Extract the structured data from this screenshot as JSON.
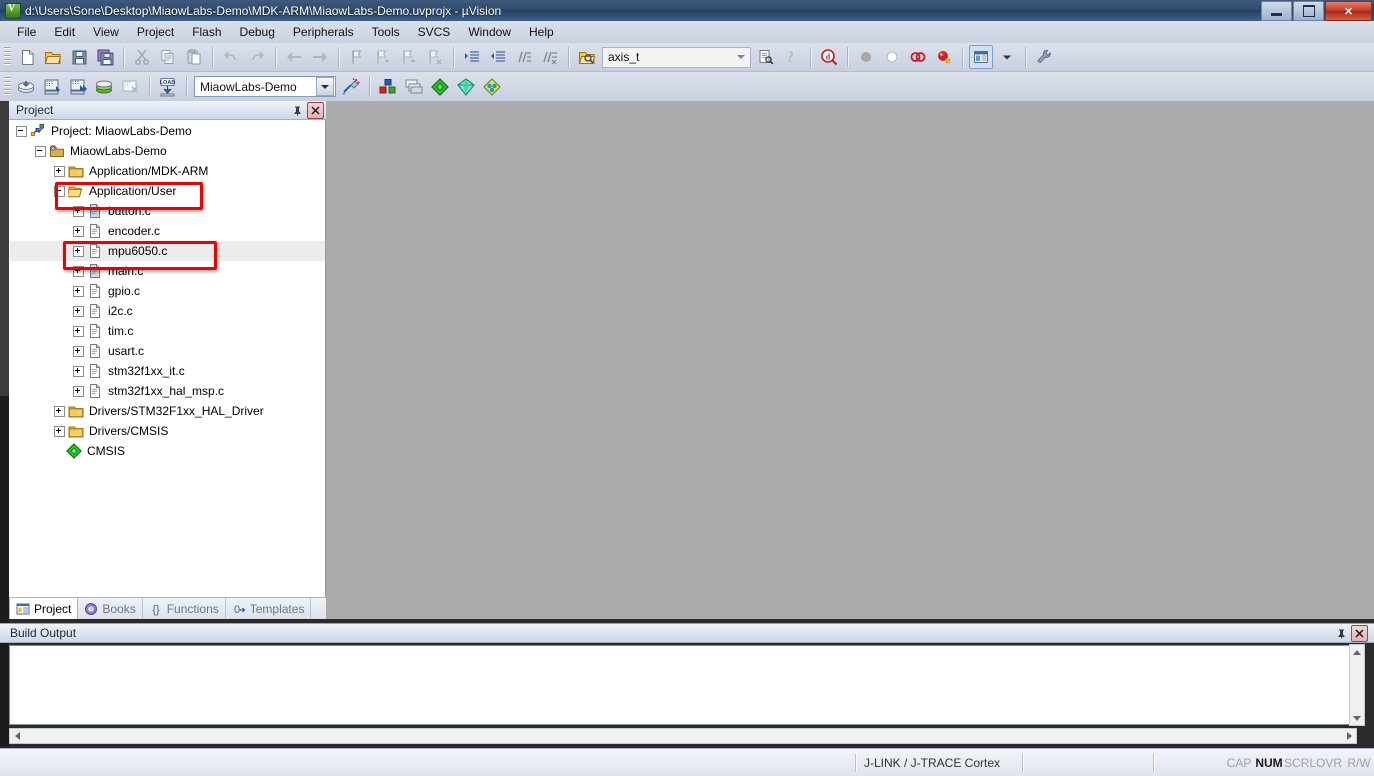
{
  "window": {
    "title": "d:\\Users\\Sone\\Desktop\\MiaowLabs-Demo\\MDK-ARM\\MiaowLabs-Demo.uvprojx - µVision",
    "minimize_label": "Minimize",
    "maximize_label": "Maximize",
    "close_label": "✕"
  },
  "menubar": {
    "items": [
      {
        "label": "File"
      },
      {
        "label": "Edit"
      },
      {
        "label": "View"
      },
      {
        "label": "Project"
      },
      {
        "label": "Flash"
      },
      {
        "label": "Debug"
      },
      {
        "label": "Peripherals"
      },
      {
        "label": "Tools"
      },
      {
        "label": "SVCS"
      },
      {
        "label": "Window"
      },
      {
        "label": "Help"
      }
    ]
  },
  "toolbar_main": {
    "buttons": [
      {
        "name": "new-file-icon",
        "tip": "New"
      },
      {
        "name": "open-file-icon",
        "tip": "Open"
      },
      {
        "name": "save-icon",
        "tip": "Save"
      },
      {
        "name": "save-all-icon",
        "tip": "Save All"
      },
      {
        "name": "cut-icon",
        "tip": "Cut"
      },
      {
        "name": "copy-icon",
        "tip": "Copy"
      },
      {
        "name": "paste-icon",
        "tip": "Paste"
      },
      {
        "name": "undo-icon",
        "tip": "Undo"
      },
      {
        "name": "redo-icon",
        "tip": "Redo"
      },
      {
        "name": "navigate-back-icon",
        "tip": "Back"
      },
      {
        "name": "navigate-forward-icon",
        "tip": "Forward"
      },
      {
        "name": "bookmark-toggle-icon",
        "tip": "Insert/Remove Bookmark"
      },
      {
        "name": "bookmark-prev-icon",
        "tip": "Previous Bookmark"
      },
      {
        "name": "bookmark-next-icon",
        "tip": "Next Bookmark"
      },
      {
        "name": "bookmark-clear-icon",
        "tip": "Clear All Bookmarks"
      },
      {
        "name": "indent-increase-icon",
        "tip": "Indent"
      },
      {
        "name": "indent-decrease-icon",
        "tip": "Outdent"
      },
      {
        "name": "comment-icon",
        "tip": "Comment"
      },
      {
        "name": "uncomment-icon",
        "tip": "Uncomment"
      }
    ],
    "find_box": {
      "value": "axis_t",
      "placeholder": ""
    },
    "find_buttons": [
      {
        "name": "find-in-files-icon",
        "tip": "Find in Files"
      },
      {
        "name": "incremental-find-icon",
        "tip": "Incremental Find"
      },
      {
        "name": "browse-symbol-icon",
        "tip": "Browse Symbol"
      }
    ],
    "debug_buttons": [
      {
        "name": "breakpoint-insert-icon",
        "tip": "Insert/Remove Breakpoint"
      },
      {
        "name": "breakpoint-enable-icon",
        "tip": "Enable/Disable Breakpoint"
      },
      {
        "name": "breakpoint-disable-all-icon",
        "tip": "Disable All Breakpoints"
      },
      {
        "name": "breakpoint-kill-all-icon",
        "tip": "Kill All Breakpoints"
      }
    ],
    "right_buttons": [
      {
        "name": "window-layout-icon",
        "tip": "Manage Window Layout"
      },
      {
        "name": "configure-icon",
        "tip": "Configuration Wizard"
      }
    ]
  },
  "toolbar_build": {
    "buttons": [
      {
        "name": "translate-icon",
        "tip": "Translate Current File"
      },
      {
        "name": "build-icon",
        "tip": "Build"
      },
      {
        "name": "rebuild-icon",
        "tip": "Rebuild"
      },
      {
        "name": "batch-build-icon",
        "tip": "Batch Build"
      },
      {
        "name": "stop-build-icon",
        "tip": "Stop Build"
      },
      {
        "name": "download-icon",
        "tip": "Download"
      }
    ],
    "target_select": {
      "value": "MiaowLabs-Demo"
    },
    "after_buttons": [
      {
        "name": "target-options-icon",
        "tip": "Options for Target"
      },
      {
        "name": "manage-project-items-icon",
        "tip": "Manage Project Items"
      },
      {
        "name": "multi-project-icon",
        "tip": "Manage Multi-Project"
      },
      {
        "name": "pack-installer-icon",
        "tip": "Pack Installer"
      },
      {
        "name": "manage-rte-icon",
        "tip": "Manage Run-Time Environment"
      },
      {
        "name": "select-software-packs-icon",
        "tip": "Select Software Packs"
      }
    ]
  },
  "project_panel": {
    "title": "Project",
    "pin_label": "Auto Hide",
    "close_label": "Close",
    "tree": [
      {
        "label": "Project: MiaowLabs-Demo",
        "depth": 0,
        "icon": "project-icon",
        "expander": "minus",
        "selected": false,
        "highlight": false
      },
      {
        "label": "MiaowLabs-Demo",
        "depth": 1,
        "icon": "target-icon",
        "expander": "minus",
        "selected": false,
        "highlight": false
      },
      {
        "label": "Application/MDK-ARM",
        "depth": 2,
        "icon": "folder-icon",
        "expander": "plus",
        "selected": false,
        "highlight": false
      },
      {
        "label": "Application/User",
        "depth": 2,
        "icon": "folder-open-icon",
        "expander": "minus",
        "selected": false,
        "highlight": true
      },
      {
        "label": "button.c",
        "depth": 3,
        "icon": "file-c-sel-icon",
        "expander": "plus",
        "selected": false,
        "highlight": false
      },
      {
        "label": "encoder.c",
        "depth": 3,
        "icon": "file-c-icon",
        "expander": "plus",
        "selected": false,
        "highlight": false
      },
      {
        "label": "mpu6050.c",
        "depth": 3,
        "icon": "file-c-icon",
        "expander": "plus",
        "selected": true,
        "highlight": true
      },
      {
        "label": "main.c",
        "depth": 3,
        "icon": "file-c-sel-icon",
        "expander": "plus",
        "selected": false,
        "highlight": false
      },
      {
        "label": "gpio.c",
        "depth": 3,
        "icon": "file-c-icon",
        "expander": "plus",
        "selected": false,
        "highlight": false
      },
      {
        "label": "i2c.c",
        "depth": 3,
        "icon": "file-c-icon",
        "expander": "plus",
        "selected": false,
        "highlight": false
      },
      {
        "label": "tim.c",
        "depth": 3,
        "icon": "file-c-icon",
        "expander": "plus",
        "selected": false,
        "highlight": false
      },
      {
        "label": "usart.c",
        "depth": 3,
        "icon": "file-c-icon",
        "expander": "plus",
        "selected": false,
        "highlight": false
      },
      {
        "label": "stm32f1xx_it.c",
        "depth": 3,
        "icon": "file-c-icon",
        "expander": "plus",
        "selected": false,
        "highlight": false
      },
      {
        "label": "stm32f1xx_hal_msp.c",
        "depth": 3,
        "icon": "file-c-icon",
        "expander": "plus",
        "selected": false,
        "highlight": false
      },
      {
        "label": "Drivers/STM32F1xx_HAL_Driver",
        "depth": 2,
        "icon": "folder-icon",
        "expander": "plus",
        "selected": false,
        "highlight": false
      },
      {
        "label": "Drivers/CMSIS",
        "depth": 2,
        "icon": "folder-icon",
        "expander": "plus",
        "selected": false,
        "highlight": false
      },
      {
        "label": "CMSIS",
        "depth": 2,
        "icon": "cmsis-icon",
        "expander": "none",
        "selected": false,
        "highlight": false
      }
    ],
    "tabs": [
      {
        "label": "Project",
        "icon": "project-tab-icon",
        "active": true
      },
      {
        "label": "Books",
        "icon": "books-tab-icon",
        "active": false
      },
      {
        "label": "Functions",
        "icon": "functions-tab-icon",
        "active": false
      },
      {
        "label": "Templates",
        "icon": "templates-tab-icon",
        "active": false
      }
    ]
  },
  "build_output": {
    "title": "Build Output",
    "content": "",
    "pin_label": "Auto Hide",
    "close_label": "Close"
  },
  "statusbar": {
    "debugger": "J-LINK / J-TRACE Cortex",
    "indicators": [
      {
        "label": "CAP",
        "active": false
      },
      {
        "label": "NUM",
        "active": true
      },
      {
        "label": "SCRL",
        "active": false
      },
      {
        "label": "OVR",
        "active": false
      },
      {
        "label": "R/W",
        "active": false
      }
    ]
  },
  "colors": {
    "highlight_red": "#ee0000",
    "mdi_background": "#ababab",
    "title_bar": "#2e4a6d",
    "selection_gray": "#ececec"
  }
}
